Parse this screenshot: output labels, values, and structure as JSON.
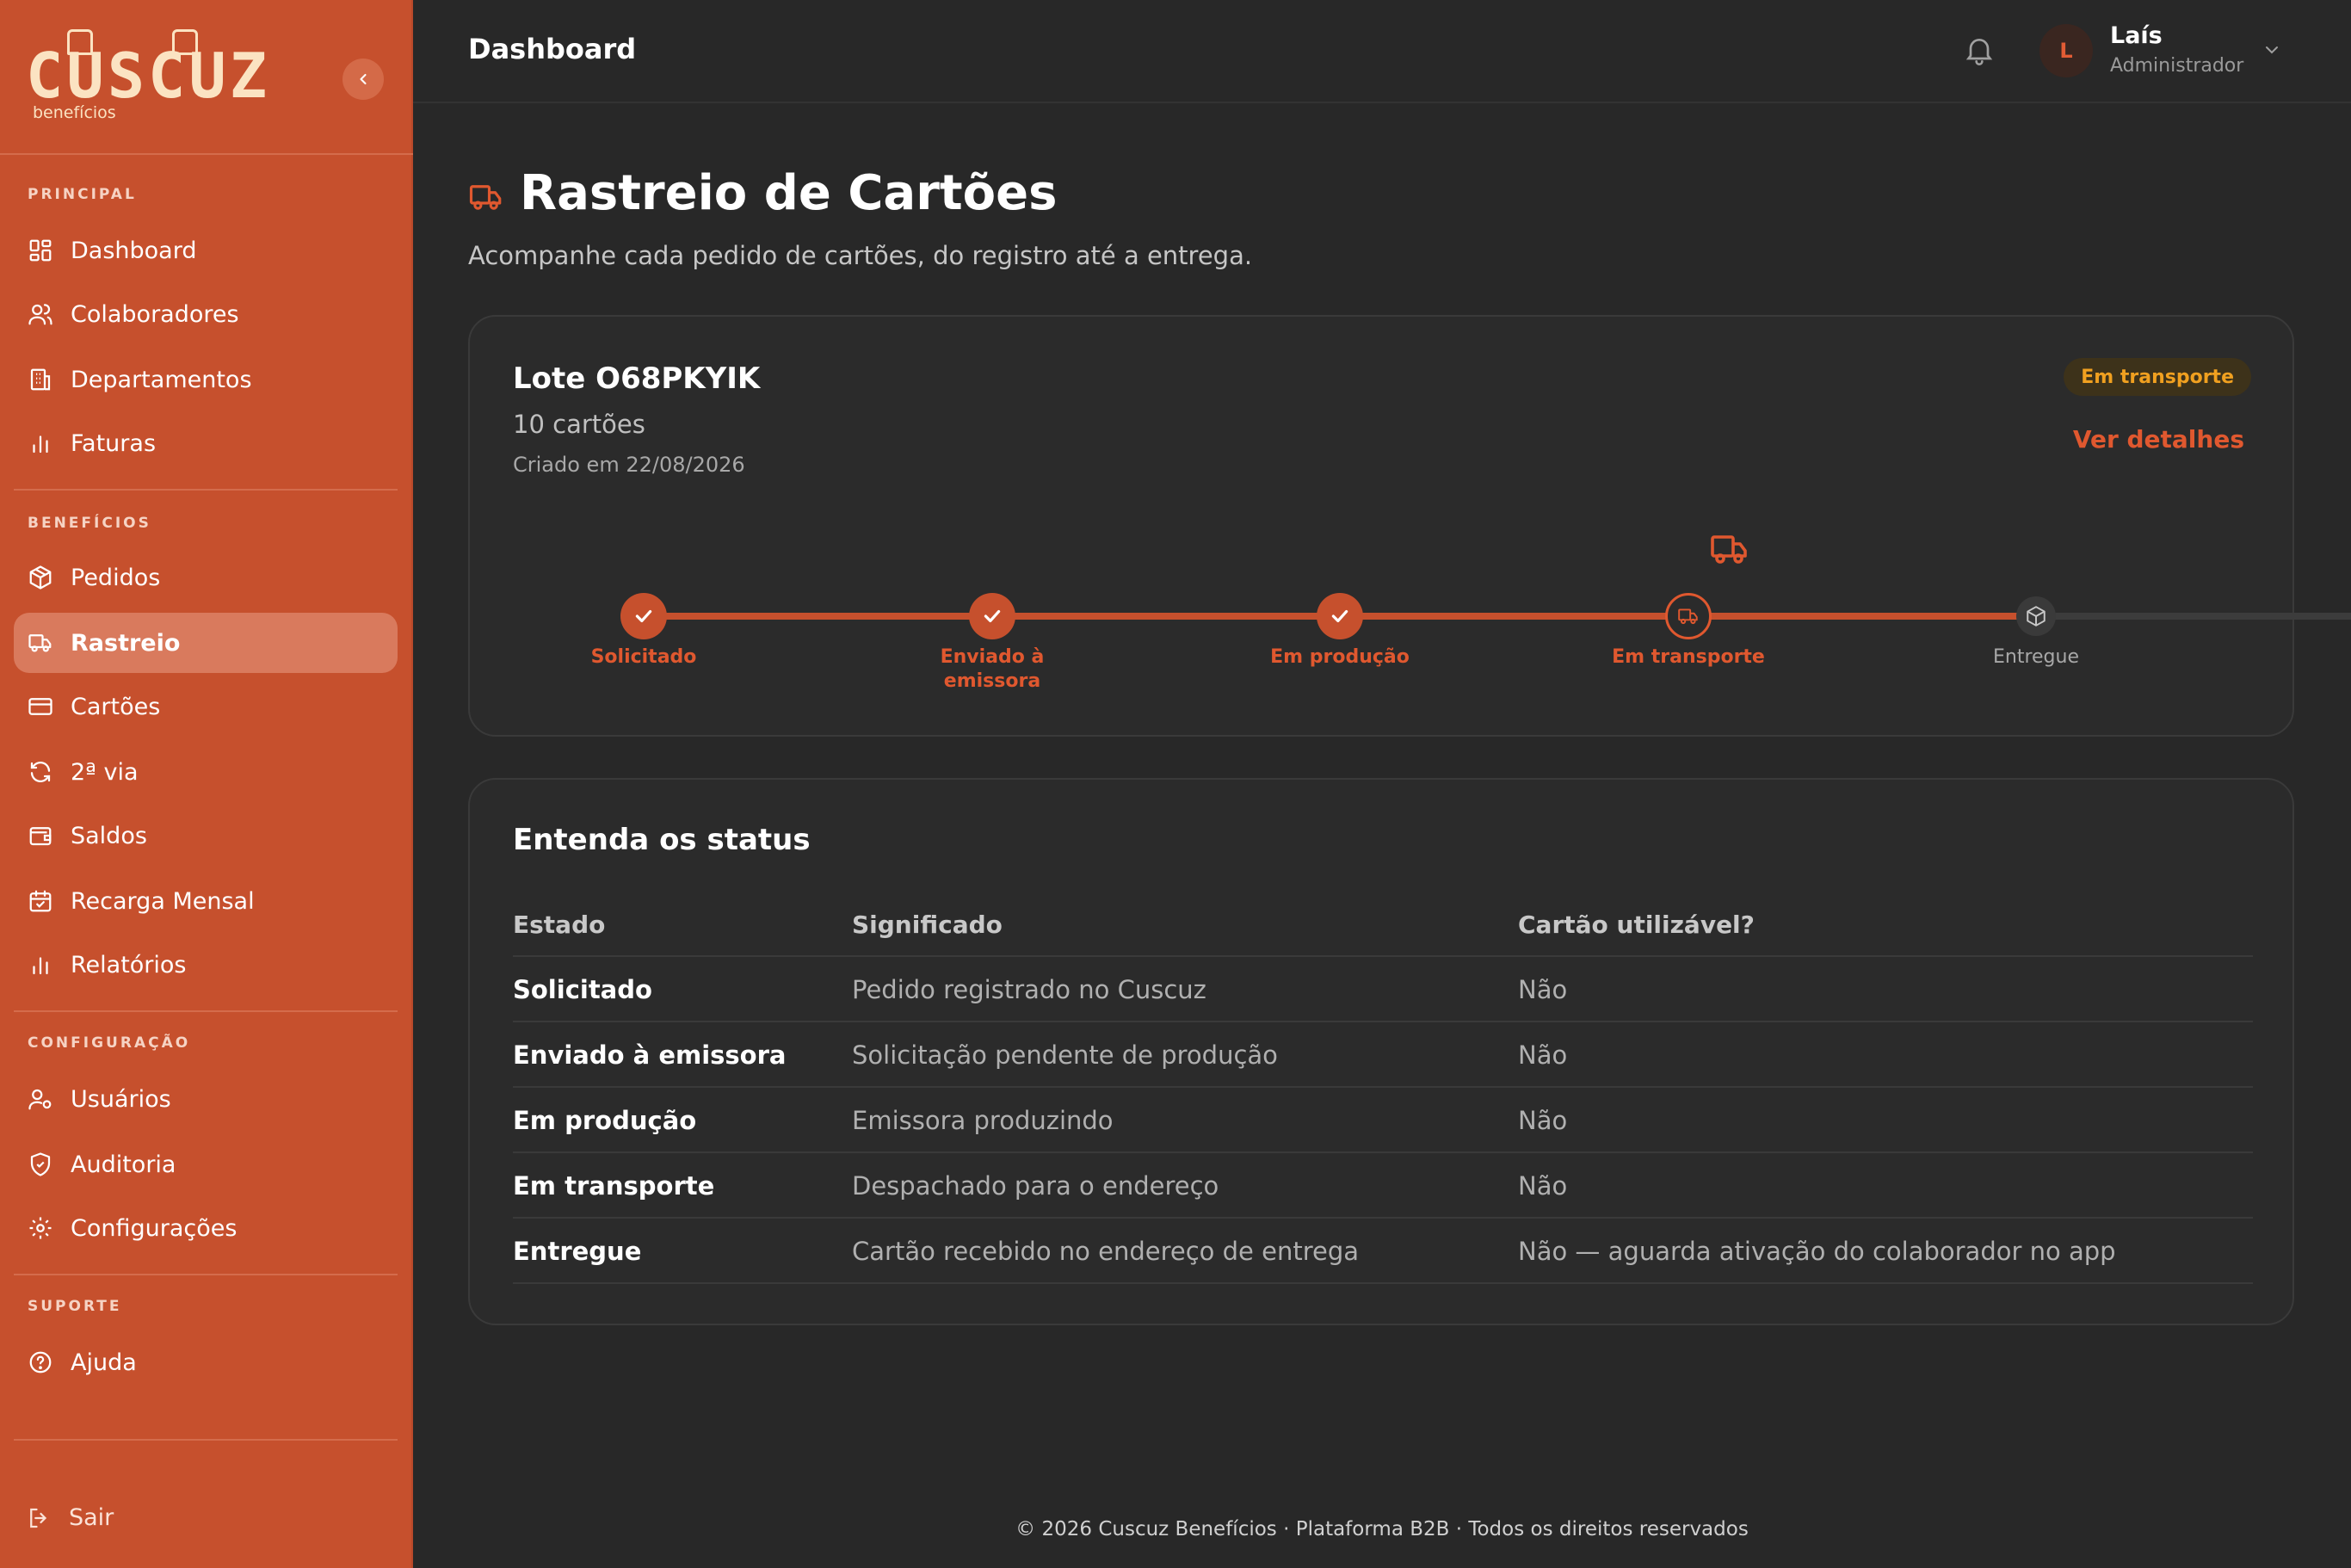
{
  "brand": {
    "logo_text": "CUSCUZ",
    "logo_sub": "benefícios",
    "primary_color": "#c6502d",
    "accent_color": "#e0582f"
  },
  "sidebar": {
    "sections": [
      {
        "label": "PRINCIPAL"
      },
      {
        "label": "BENEFÍCIOS"
      },
      {
        "label": "CONFIGURAÇÃO"
      },
      {
        "label": "SUPORTE"
      }
    ],
    "items": [
      {
        "label": "Dashboard",
        "icon": "grid-icon"
      },
      {
        "label": "Colaboradores",
        "icon": "users-icon"
      },
      {
        "label": "Departamentos",
        "icon": "building-icon"
      },
      {
        "label": "Faturas",
        "icon": "bar-chart-icon"
      },
      {
        "label": "Pedidos",
        "icon": "package-icon"
      },
      {
        "label": "Rastreio",
        "icon": "truck-icon",
        "active": true
      },
      {
        "label": "Cartões",
        "icon": "credit-card-icon"
      },
      {
        "label": "2ª via",
        "icon": "refresh-icon"
      },
      {
        "label": "Saldos",
        "icon": "wallet-icon"
      },
      {
        "label": "Recarga Mensal",
        "icon": "calendar-check-icon"
      },
      {
        "label": "Relatórios",
        "icon": "bar-chart-icon"
      },
      {
        "label": "Usuários",
        "icon": "user-key-icon"
      },
      {
        "label": "Auditoria",
        "icon": "shield-check-icon"
      },
      {
        "label": "Configurações",
        "icon": "gear-icon"
      },
      {
        "label": "Ajuda",
        "icon": "help-circle-icon"
      }
    ],
    "logout_label": "Sair"
  },
  "header": {
    "title": "Dashboard",
    "user": {
      "initial": "L",
      "name": "Laís",
      "role": "Administrador"
    }
  },
  "page": {
    "title": "Rastreio de Cartões",
    "subtitle": "Acompanhe cada pedido de cartões, do registro até a entrega."
  },
  "order": {
    "title": "Lote O68PKYIK",
    "cards_count": "10 cartões",
    "created": "Criado em 22/08/2026",
    "status_badge": "Em transporte",
    "details_link": "Ver detalhes",
    "current_step": 4,
    "steps": [
      {
        "line1": "Solicitado",
        "line2": "",
        "state": "done"
      },
      {
        "line1": "Enviado à",
        "line2": "emissora",
        "state": "done"
      },
      {
        "line1": "Em produção",
        "line2": "",
        "state": "done"
      },
      {
        "line1": "Em transporte",
        "line2": "",
        "state": "current"
      },
      {
        "line1": "Entregue",
        "line2": "",
        "state": "todo"
      }
    ]
  },
  "legend": {
    "title": "Entenda os status",
    "columns": [
      "Estado",
      "Significado",
      "Cartão utilizável?"
    ],
    "rows": [
      [
        "Solicitado",
        "Pedido registrado no Cuscuz",
        "Não"
      ],
      [
        "Enviado à emissora",
        "Solicitação pendente de produção",
        "Não"
      ],
      [
        "Em produção",
        "Emissora produzindo",
        "Não"
      ],
      [
        "Em transporte",
        "Despachado para o endereço",
        "Não"
      ],
      [
        "Entregue",
        "Cartão recebido no endereço de entrega",
        "Não — aguarda ativação do colaborador no app"
      ]
    ]
  },
  "footer": {
    "text": "© 2026 Cuscuz Benefícios · Plataforma B2B · Todos os direitos reservados"
  }
}
